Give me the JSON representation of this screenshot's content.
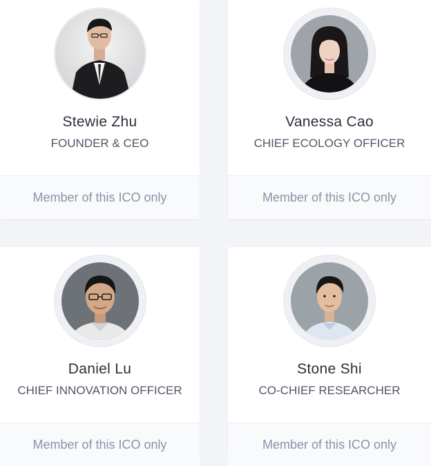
{
  "team": [
    {
      "name": "Stewie Zhu",
      "role": "FOUNDER & CEO",
      "footer": "Member of this ICO only",
      "avatar_icon": "person-photo-icon"
    },
    {
      "name": "Vanessa Cao",
      "role": "CHIEF ECOLOGY OFFICER",
      "footer": "Member of this ICO only",
      "avatar_icon": "person-photo-icon"
    },
    {
      "name": "Daniel Lu",
      "role": "CHIEF INNOVATION OFFICER",
      "footer": "Member of this ICO only",
      "avatar_icon": "person-photo-icon"
    },
    {
      "name": "Stone Shi",
      "role": "CO-CHIEF RESEARCHER",
      "footer": "Member of this ICO only",
      "avatar_icon": "person-photo-icon"
    }
  ],
  "colors": {
    "page_bg": "#f3f4f8",
    "card_bg": "#ffffff",
    "footer_text": "#8a92a6",
    "name_text": "#2b2f3a"
  }
}
